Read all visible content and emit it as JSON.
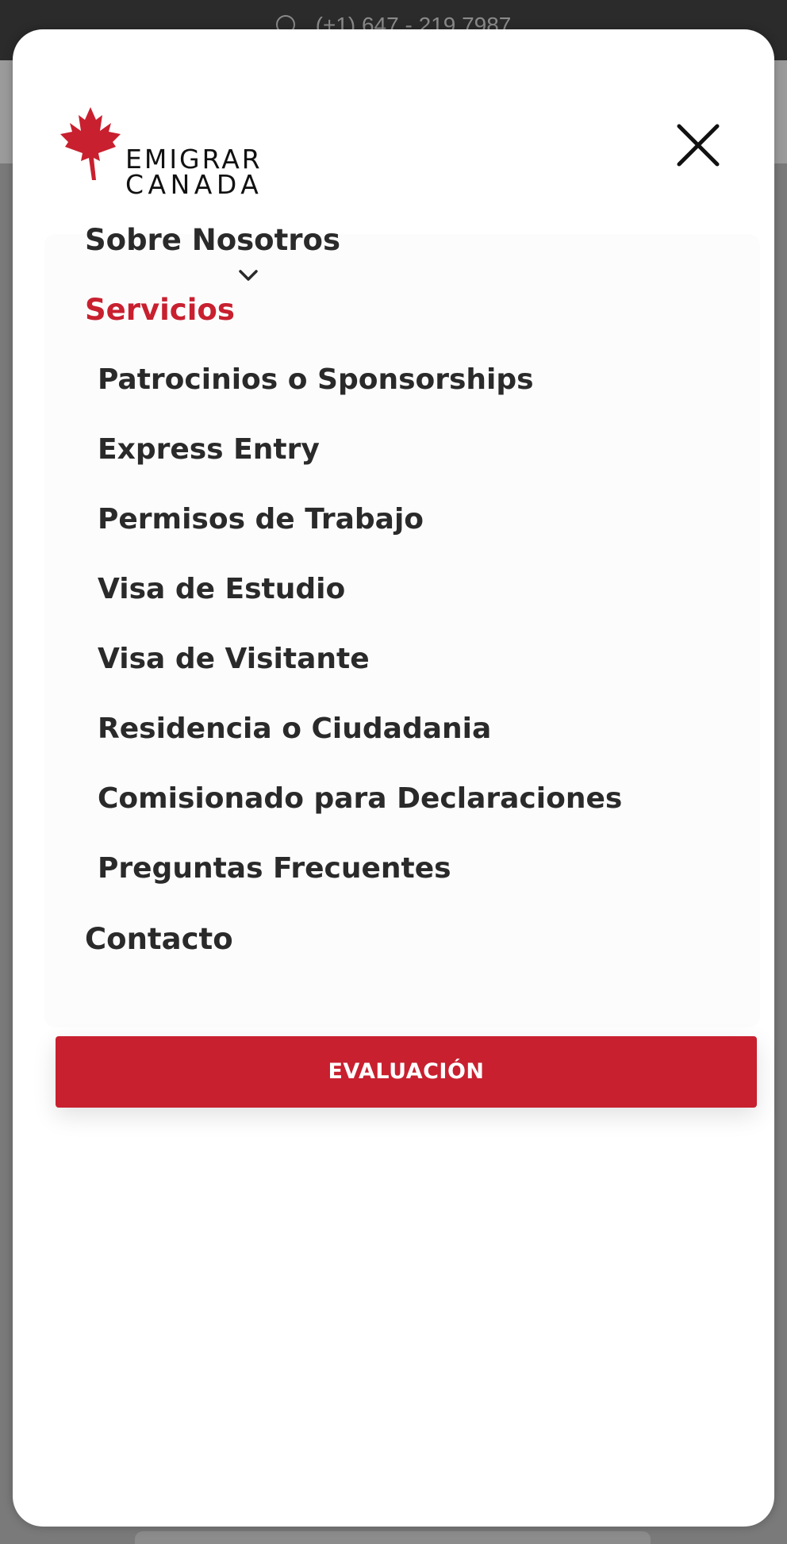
{
  "topbar": {
    "phone": "(+1) 647 - 219 7987"
  },
  "logo": {
    "line1": "EMIGRAR",
    "line2": "CANADA",
    "icon": "maple-leaf-icon",
    "leaf_color": "#c8202f"
  },
  "close": {
    "icon": "close-icon"
  },
  "menu": {
    "items": [
      {
        "label": "Sobre Nosotros"
      },
      {
        "label": "Servicios",
        "expanded": true
      },
      {
        "label": "Contacto"
      }
    ],
    "submenu": [
      {
        "label": "Patrocinios o Sponsorships"
      },
      {
        "label": "Express Entry"
      },
      {
        "label": "Permisos de Trabajo"
      },
      {
        "label": "Visa de Estudio"
      },
      {
        "label": "Visa de Visitante"
      },
      {
        "label": "Residencia o Ciudadania"
      },
      {
        "label": "Comisionado para Declaraciones"
      },
      {
        "label": "Preguntas Frecuentes"
      }
    ]
  },
  "cta": {
    "label": "EVALUACIÓN"
  },
  "colors": {
    "accent": "#c8202f",
    "text": "#2a2a2a"
  }
}
